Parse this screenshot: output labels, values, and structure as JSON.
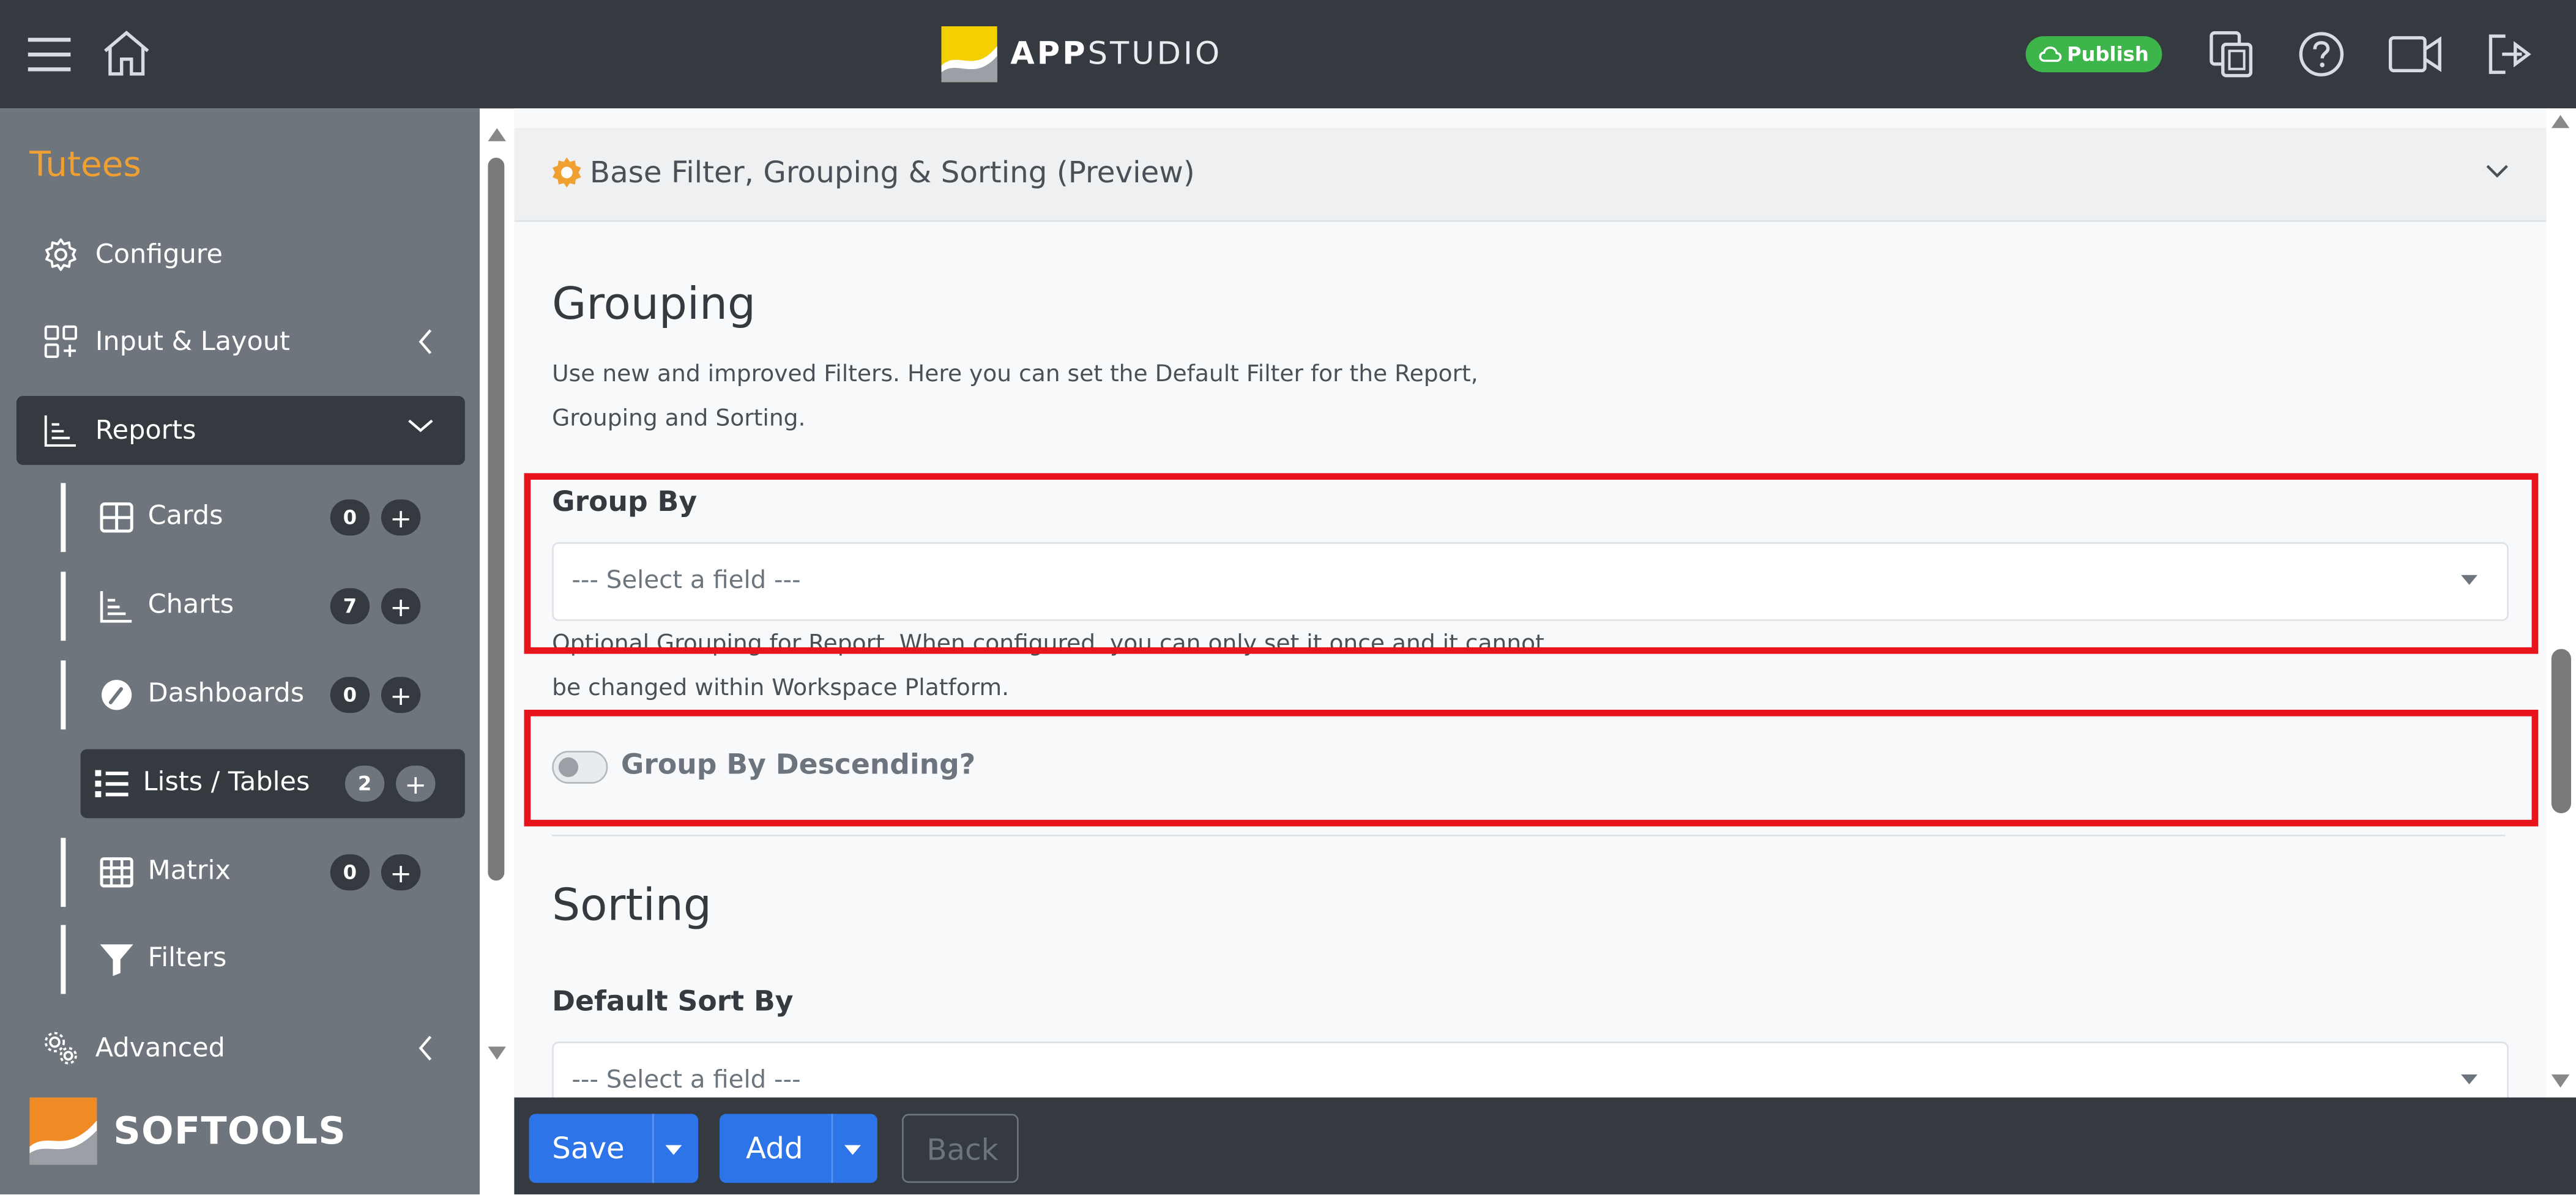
{
  "header": {
    "brand_bold": "APP",
    "brand_light": "STUDIO",
    "publish_label": "Publish"
  },
  "sidebar": {
    "app_title": "Tutees",
    "items": [
      {
        "label": "Configure"
      },
      {
        "label": "Input & Layout"
      },
      {
        "label": "Reports"
      }
    ],
    "sub_items": [
      {
        "label": "Cards",
        "count": "0",
        "plus": "+"
      },
      {
        "label": "Charts",
        "count": "7",
        "plus": "+"
      },
      {
        "label": "Dashboards",
        "count": "0",
        "plus": "+"
      },
      {
        "label": "Lists / Tables",
        "count": "2",
        "plus": "+"
      },
      {
        "label": "Matrix",
        "count": "0",
        "plus": "+"
      },
      {
        "label": "Filters"
      }
    ],
    "advanced_label": "Advanced",
    "brand": "SOFTOOLS"
  },
  "main": {
    "accordion_title": "Base Filter, Grouping & Sorting (Preview)",
    "grouping_title": "Grouping",
    "grouping_desc": "Use new and improved Filters. Here you can set the Default Filter for the Report, Grouping and Sorting.",
    "group_by_label": "Group By",
    "group_by_placeholder": "--- Select a field ---",
    "group_by_help": "Optional Grouping for Report. When configured, you can only set it once and it cannot be changed within Workspace Platform.",
    "group_desc_label": "Group By Descending?",
    "sorting_title": "Sorting",
    "sort_by_label": "Default Sort By",
    "sort_by_placeholder": "--- Select a field ---"
  },
  "footer": {
    "save_label": "Save",
    "add_label": "Add",
    "back_label": "Back"
  },
  "colors": {
    "header_bg": "#343a40",
    "sidebar_bg": "#6e757c",
    "accent_orange": "#f0a030",
    "publish_green": "#3db54a",
    "primary_blue": "#2d74e8",
    "highlight_red": "#e8141b"
  }
}
